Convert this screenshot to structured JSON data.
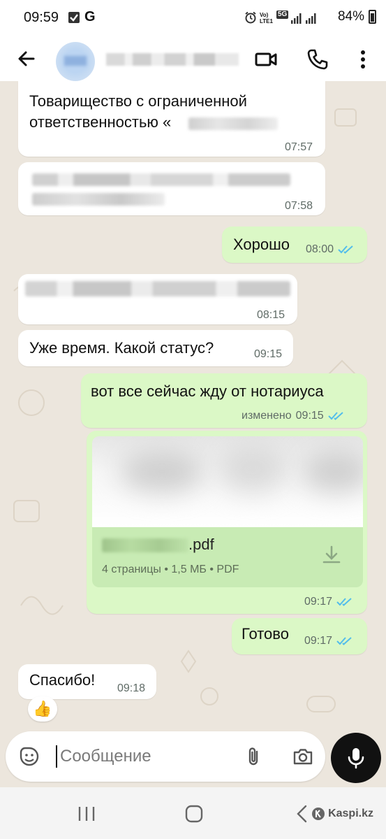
{
  "status_bar": {
    "time": "09:59",
    "g_label": "G",
    "network_label": "5G",
    "battery": "84%"
  },
  "header": {
    "back_icon": "arrow-left-icon",
    "video_icon": "video-call-icon",
    "call_icon": "phone-icon",
    "menu_icon": "more-vert-icon"
  },
  "messages": [
    {
      "direction": "in",
      "text_lines": [
        "Товарищество с ограниченной",
        "ответственностью «"
      ],
      "time": "07:57"
    },
    {
      "direction": "in",
      "time": "07:58"
    },
    {
      "direction": "out",
      "text": "Хорошо",
      "time": "08:00"
    },
    {
      "direction": "in",
      "time": "08:15"
    },
    {
      "direction": "in",
      "text": "Уже время. Какой статус?",
      "time": "09:15"
    },
    {
      "direction": "out",
      "text": "вот все сейчас жду от нотариуса",
      "edited": "изменено",
      "time": "09:15"
    },
    {
      "direction": "out",
      "file": {
        "name": ".pdf",
        "details": "4 страницы • 1,5 МБ • PDF"
      },
      "time": "09:17"
    },
    {
      "direction": "out",
      "text": "Готово",
      "time": "09:17"
    },
    {
      "direction": "in",
      "text": "Спасибо!",
      "time": "09:18",
      "reaction": "👍"
    }
  ],
  "composer": {
    "placeholder": "Сообщение",
    "emoji_icon": "sticker-icon",
    "attach_icon": "paperclip-icon",
    "camera_icon": "camera-icon",
    "mic_icon": "microphone-icon"
  },
  "watermark": "Kaspi.kz",
  "colors": {
    "outgoing_bubble": "#dbf8c6",
    "incoming_bubble": "#ffffff",
    "tick_blue": "#53bdeb",
    "chat_background": "#ece6dd"
  }
}
